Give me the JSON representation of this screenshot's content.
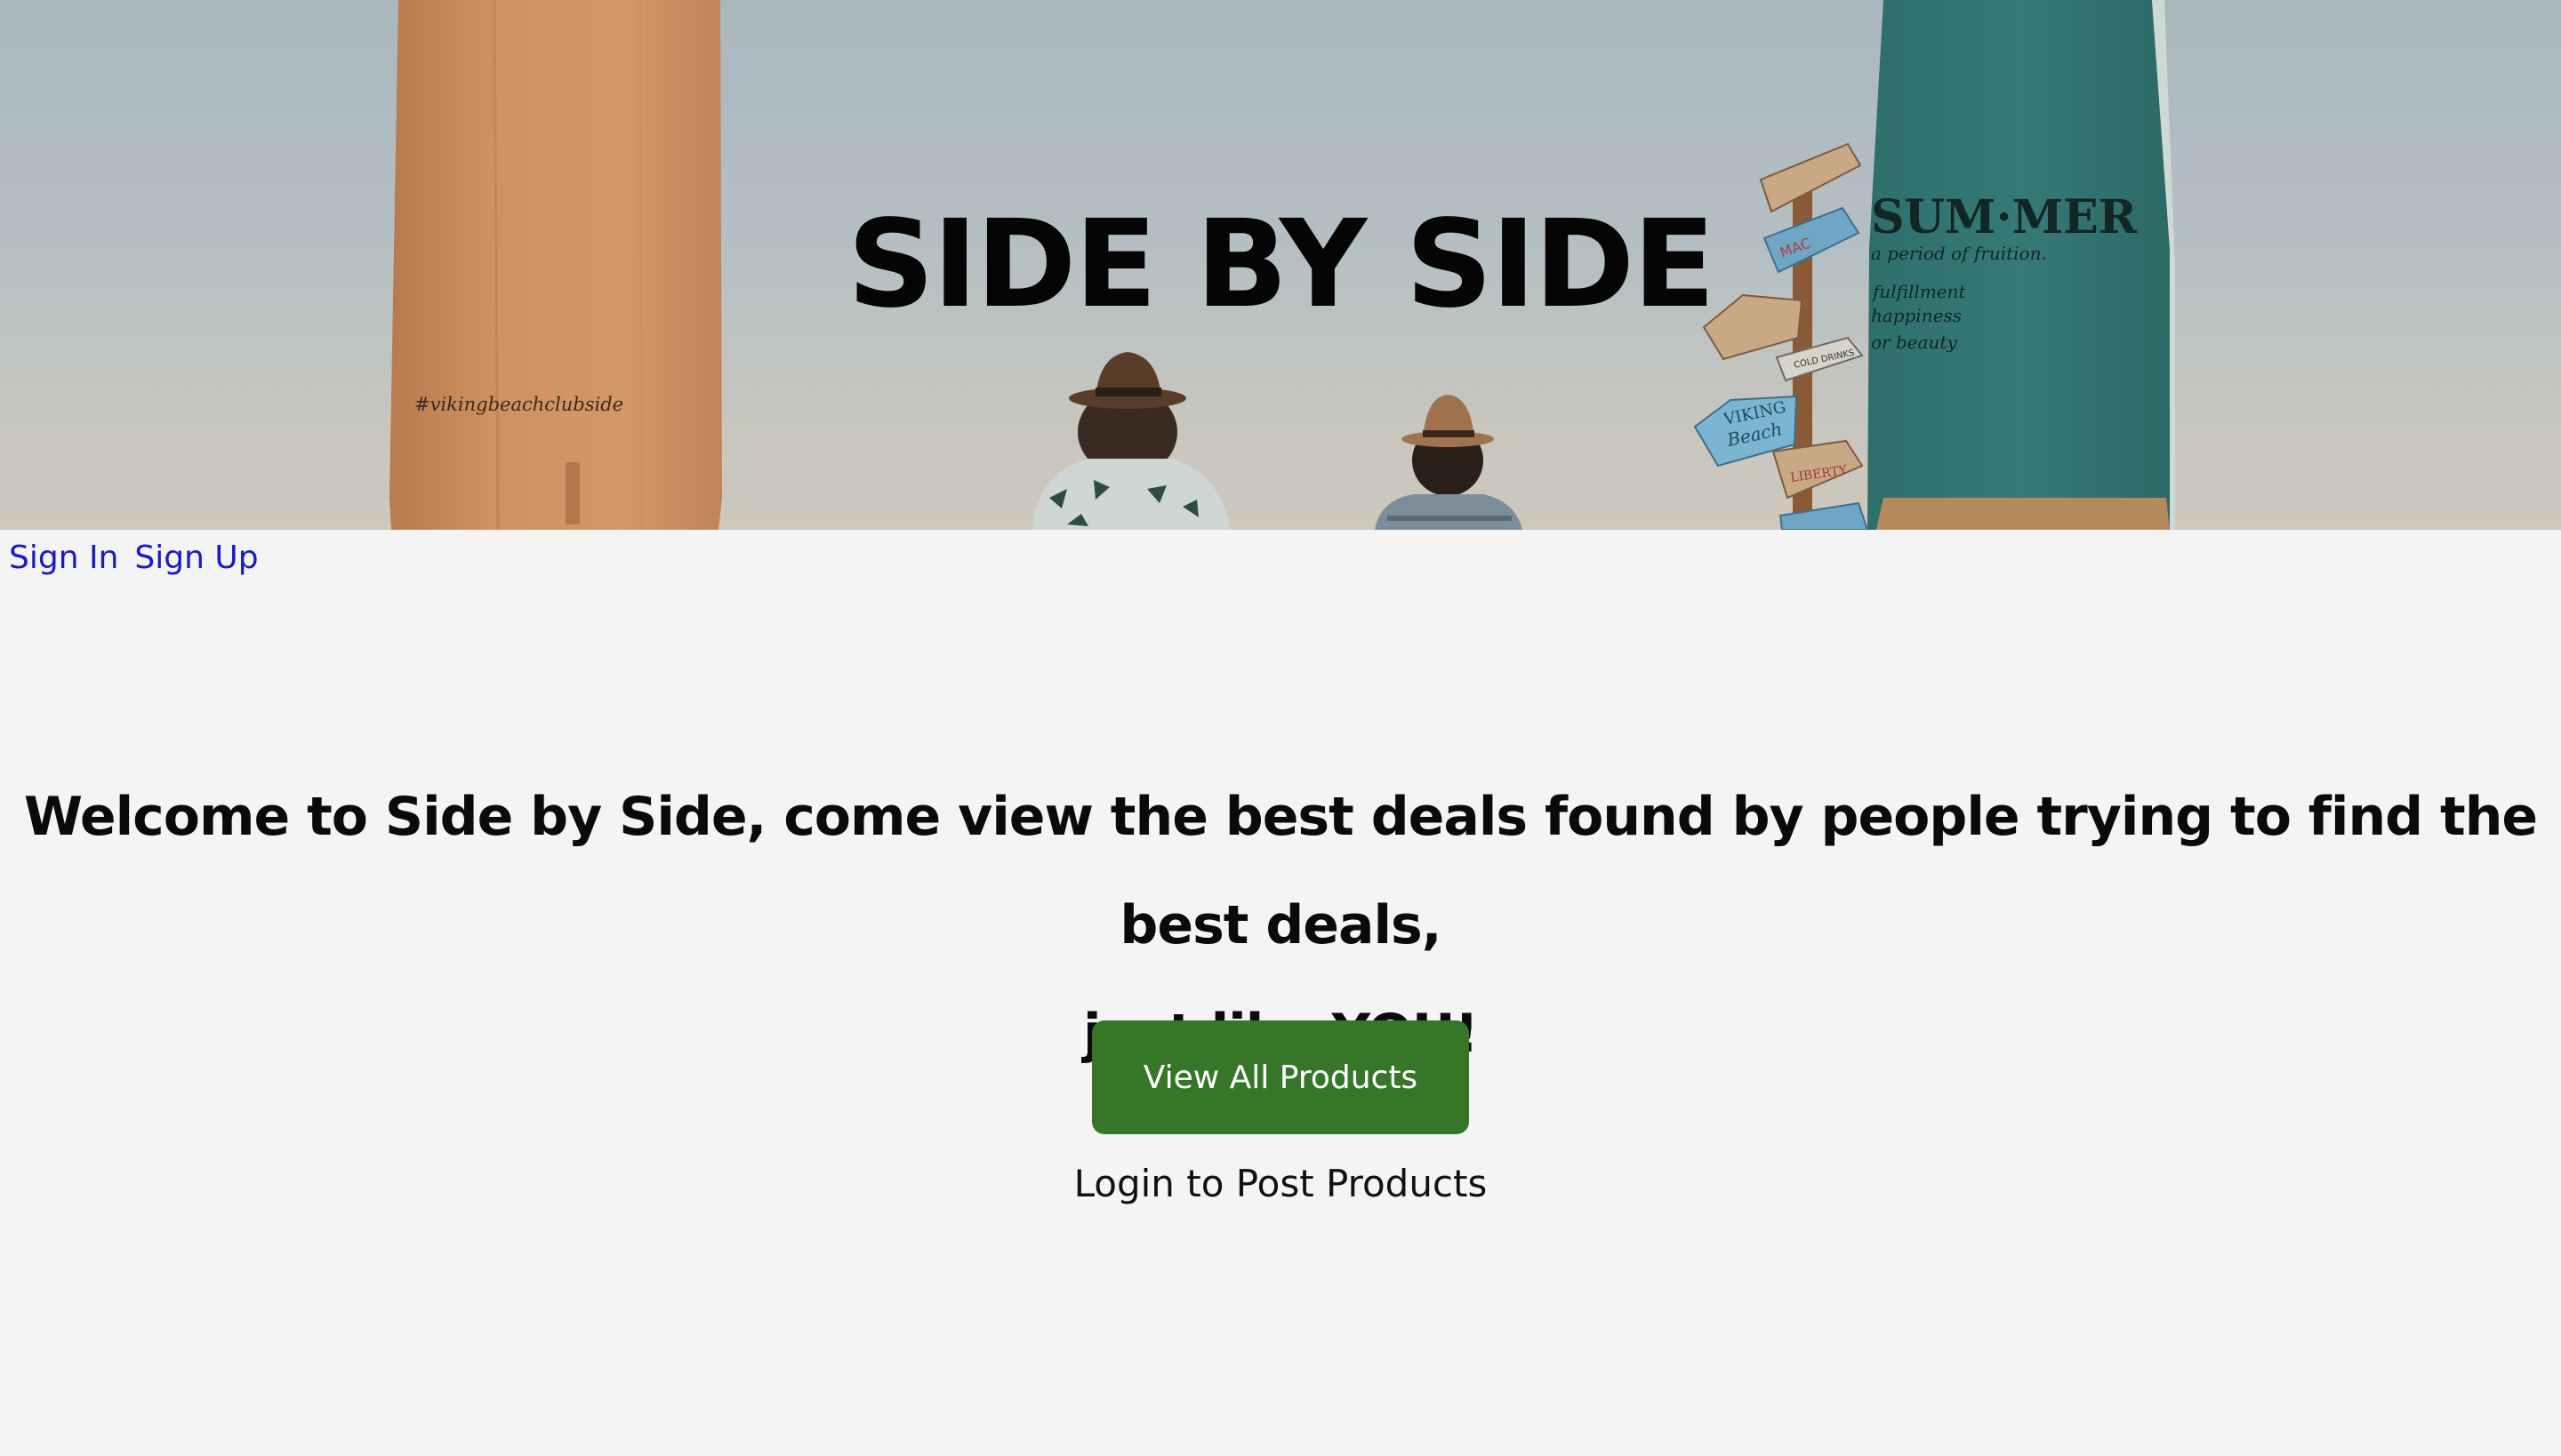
{
  "hero": {
    "title": "SIDE BY SIDE",
    "left_board_text": "#vikingbeachclubside",
    "right_board": {
      "headline": "SUM·MER",
      "line1": "a period of fruition.",
      "line2": "fulfillment",
      "line3": "happiness",
      "line4": "or beauty"
    },
    "signs": [
      "VIKING",
      "Beach",
      "COLD DRINKS",
      "MAC",
      "LIBERTY"
    ]
  },
  "auth": {
    "sign_in": "Sign In",
    "sign_up": "Sign Up"
  },
  "main": {
    "welcome_line1": "Welcome to Side by Side, come view the best deals found by people trying to find the best deals,",
    "welcome_line2": "just like YOU!",
    "view_button": "View All Products",
    "login_note": "Login to Post Products"
  },
  "colors": {
    "button_bg": "#367629",
    "link": "#1a1acd",
    "background": "#f4f4f4"
  }
}
